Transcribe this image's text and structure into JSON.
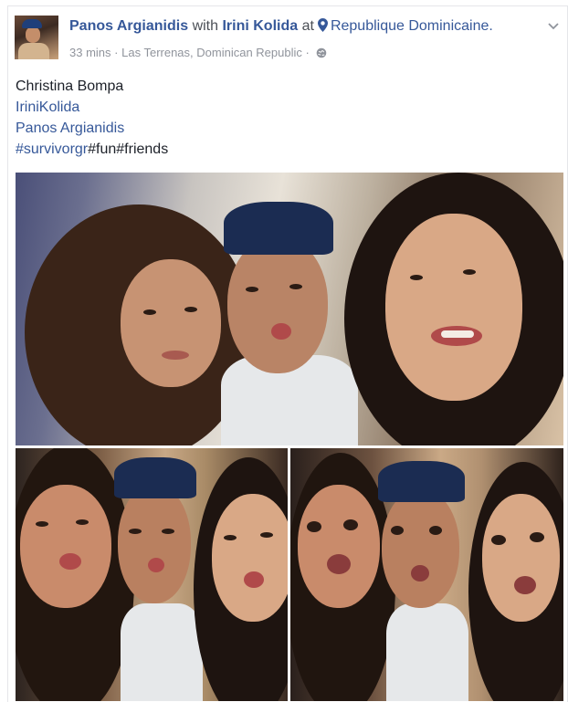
{
  "post": {
    "author": "Panos Argianidis",
    "with_word": "with",
    "tagged": "Irini Kolida",
    "at_word": "at",
    "location": "Republique Dominicaine.",
    "time": "33 mins",
    "separator": "·",
    "place_line": "Las Terrenas, Dominican Republic",
    "privacy_icon": "globe-icon",
    "menu_icon": "chevron-down-icon",
    "location_icon": "map-pin-icon"
  },
  "body": {
    "line1": "Christina Bompa",
    "line2": "IriniKolida",
    "line3": "Panos Argianidis",
    "tag1": "#survivorgr",
    "tag2": "#fun",
    "tag3": "#friends"
  },
  "colors": {
    "link": "#365899",
    "text": "#1d2129",
    "muted": "#90949c"
  }
}
